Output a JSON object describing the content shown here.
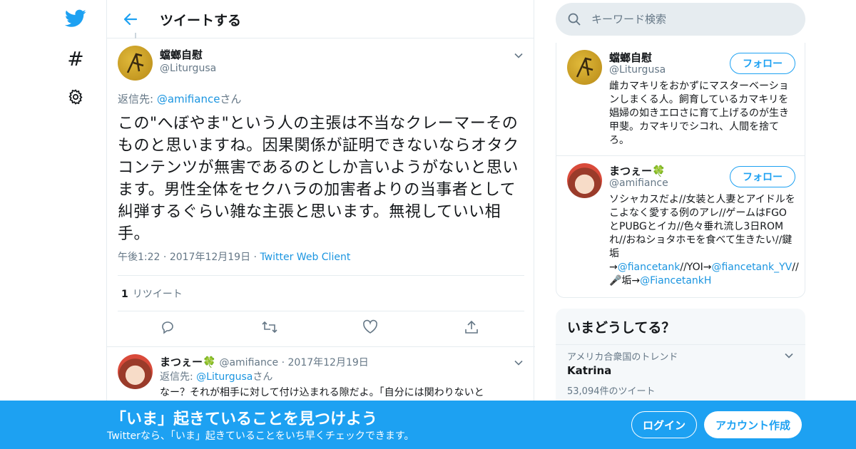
{
  "header": {
    "title": "ツイートする"
  },
  "tweet": {
    "author_name": "蟷螂自慰",
    "author_handle": "@Liturgusa",
    "reply_prefix": "返信先: ",
    "reply_to": "@amifiance",
    "reply_suffix": "さん",
    "text": "この\"へぼやま\"という人の主張は不当なクレーマーそのものと思いますね。因果関係が証明できないならオタクコンテンツが無害であるのとしか言いようがないと思います。男性全体をセクハラの加害者よりの当事者として糾弾するぐらい雑な主張と思います。無視していい相手。",
    "time": "午後1:22",
    "date": "2017年12月19日",
    "client": "Twitter Web Client",
    "retweet_count": "1",
    "retweet_label": "リツイート"
  },
  "reply": {
    "author_name": "まつぇー🍀",
    "author_handle": "@amifiance",
    "date": "2017年12月19日",
    "reply_prefix": "返信先: ",
    "reply_to": "@Liturgusa",
    "reply_suffix": "さん",
    "text": "なー？それが相手に対して付け込まれる隙だよ。「自分には関わりないと"
  },
  "search": {
    "placeholder": "キーワード検索"
  },
  "who_to_follow": [
    {
      "name": "蟷螂自慰",
      "handle": "@Liturgusa",
      "follow_label": "フォロー",
      "bio": "雌カマキリをおかずにマスターベーションしまくる人。飼育しているカマキリを娼婦の如きエロさに育て上げるのが生き甲斐。カマキリでシコれ、人間を捨てろ。"
    },
    {
      "name": "まつぇー🍀",
      "handle": "@amifiance",
      "follow_label": "フォロー",
      "bio_1": "ソシャカスだよ//女装と人妻とアイドルをこよなく愛する例のアレ//ゲームはFGOとPUBGとイカ//色々垂れ流し3日ROMれ//おねショタホモを食べて生きたい//鍵垢→",
      "bio_link_1": "@fiancetank",
      "bio_2": "//YOI→",
      "bio_link_2": "@fiancetank_YV",
      "bio_3": "//🎤垢→",
      "bio_link_3": "@FiancetankH"
    }
  ],
  "trends": {
    "title": "いまどうしてる？",
    "category": "アメリカ合衆国のトレンド",
    "name": "Katrina",
    "count": "53,094件のツイート"
  },
  "banner": {
    "title": "「いま」起きていることを見つけよう",
    "subtitle": "Twitterなら、「いま」起きていることをいち早くチェックできます。",
    "login_label": "ログイン",
    "signup_label": "アカウント作成"
  },
  "colors": {
    "accent": "#1da1f2",
    "link": "#1b95e0",
    "muted": "#657786",
    "border": "#e6ecf0"
  }
}
